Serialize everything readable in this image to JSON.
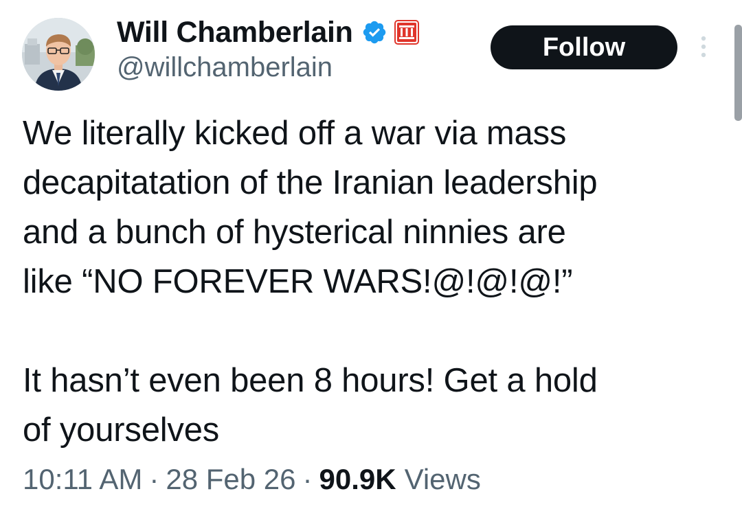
{
  "author": {
    "display_name": "Will Chamberlain",
    "handle": "@willchamberlain",
    "verified_icon": "verified-badge-icon",
    "affiliate_icon": "affiliate-badge-icon",
    "avatar_icon": "profile-photo"
  },
  "actions": {
    "follow_label": "Follow",
    "more_icon": "more-options-icon"
  },
  "tweet": {
    "paragraph_1": "We literally kicked off a war via mass\ndecapitatation of the Iranian leadership\nand a bunch of hysterical ninnies are\nlike “NO FOREVER WARS!@!@!@!”",
    "paragraph_2": "It hasn’t even been 8 hours! Get a hold\nof yourselves"
  },
  "meta": {
    "time": "10:11 AM",
    "separator": "·",
    "date": "28 Feb 26",
    "views_count": "90.9K",
    "views_label": "Views"
  },
  "colors": {
    "text_primary": "#0f1419",
    "text_secondary": "#536471",
    "verified_blue": "#1d9bf0",
    "affiliate_red": "#e0352b",
    "follow_bg": "#0f1419"
  }
}
